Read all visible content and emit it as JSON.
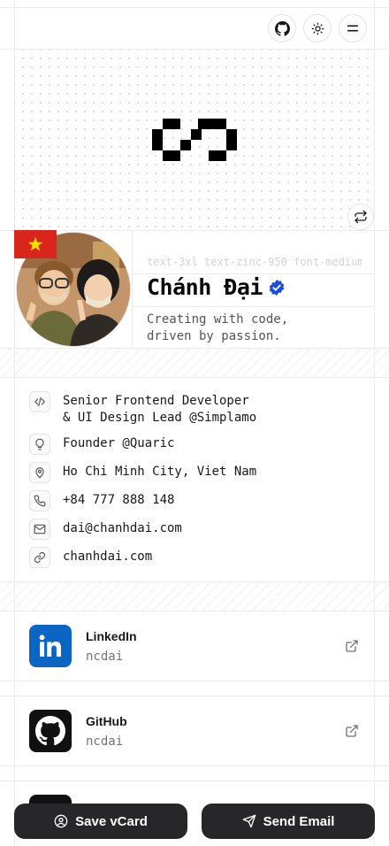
{
  "profile": {
    "ghost_text": "text-3xl text-zinc-950 font-medium",
    "name": "Chánh Đại",
    "bio_line1": "Creating with code,",
    "bio_line2": "driven by passion."
  },
  "info": [
    {
      "icon": "code-icon",
      "line1": "Senior Frontend Developer",
      "line2": "& UI Design Lead @Simplamo"
    },
    {
      "icon": "lightbulb-icon",
      "line1": "Founder @Quaric"
    },
    {
      "icon": "map-pin-icon",
      "line1": "Ho Chi Minh City, Viet Nam"
    },
    {
      "icon": "phone-icon",
      "line1": "+84 777 888 148"
    },
    {
      "icon": "mail-icon",
      "line1": "dai@chanhdai.com"
    },
    {
      "icon": "link-icon",
      "line1": "chanhdai.com"
    }
  ],
  "social": [
    {
      "title": "LinkedIn",
      "handle": "ncdai",
      "color": "#0a66c2"
    },
    {
      "title": "GitHub",
      "handle": "ncdai",
      "color": "#111111"
    }
  ],
  "actions": {
    "save_vcard": "Save vCard",
    "send_email": "Send Email"
  },
  "colors": {
    "verified": "#1d4ed8",
    "flag_red": "#da251d",
    "flag_star": "#ffde00"
  }
}
